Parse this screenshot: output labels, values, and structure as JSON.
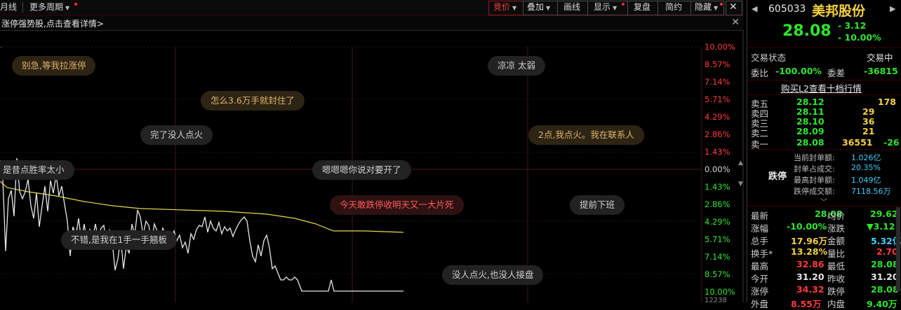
{
  "toolbar": {
    "left_items": [
      {
        "label": "月线"
      },
      {
        "label": "更多周期"
      }
    ],
    "right_items": [
      {
        "label": "竞价",
        "active": true
      },
      {
        "label": "叠加"
      },
      {
        "label": "画线"
      },
      {
        "label": "显示"
      },
      {
        "label": "复盘"
      },
      {
        "label": "简约"
      },
      {
        "label": "隐藏"
      }
    ],
    "close_icon": "close-icon"
  },
  "infobar": {
    "text": "涨停强势股,点击查看详情>"
  },
  "chart": {
    "pct_labels": [
      {
        "text": "10.00%",
        "color": "#ff3b3b"
      },
      {
        "text": "8.57%",
        "color": "#ff3b3b"
      },
      {
        "text": "7.14%",
        "color": "#ff3b3b"
      },
      {
        "text": "5.71%",
        "color": "#ff3b3b"
      },
      {
        "text": "4.29%",
        "color": "#ff3b3b"
      },
      {
        "text": "2.86%",
        "color": "#ff3b3b"
      },
      {
        "text": "1.43%",
        "color": "#ff3b3b"
      },
      {
        "text": "0.00%",
        "color": "#d8d8d8"
      },
      {
        "text": "1.43%",
        "color": "#2ee62e"
      },
      {
        "text": "2.86%",
        "color": "#2ee62e"
      },
      {
        "text": "4.29%",
        "color": "#2ee62e"
      },
      {
        "text": "5.71%",
        "color": "#2ee62e"
      },
      {
        "text": "7.14%",
        "color": "#2ee62e"
      },
      {
        "text": "8.57%",
        "color": "#2ee62e"
      },
      {
        "text": "10.00%",
        "color": "#2ee62e"
      }
    ],
    "bottom_partial": "12238",
    "bubbles": [
      {
        "text": "别急,等我拉涨停",
        "style": "yellow"
      },
      {
        "text": "怎么3.6万手就封住了",
        "style": "yellow"
      },
      {
        "text": "完了没人点火",
        "style": "gray"
      },
      {
        "text": "是昔点胜率太小",
        "style": "gray"
      },
      {
        "text": "嗯嗯嗯你说对要开了",
        "style": "gray"
      },
      {
        "text": "今天敢跌停收明天又一大片死",
        "style": "red"
      },
      {
        "text": "不错,是我在1手一手翘板",
        "style": "gray"
      },
      {
        "text": "凉凉 太弱",
        "style": "gray"
      },
      {
        "text": "2点,我点火。我在联系人",
        "style": "yellow"
      },
      {
        "text": "提前下班",
        "style": "gray"
      },
      {
        "text": "没人点火,也没人接盘",
        "style": "gray"
      }
    ]
  },
  "panel": {
    "code": "605033",
    "name": "美邦股份",
    "price": "28.08",
    "change": "- 3.12",
    "change_pct": "- 10.00%",
    "status_label": "交易状态",
    "status_value": "交易中",
    "weibi_label": "委比",
    "weibi_value": "-100.00%",
    "weicha_label": "委差",
    "weicha_value": "-36815",
    "l2_link": "购买L2查看十档行情",
    "asks": [
      {
        "label": "卖五",
        "price": "28.12",
        "vol": "178",
        "diff": ""
      },
      {
        "label": "卖四",
        "price": "28.11",
        "vol": "29",
        "diff": ""
      },
      {
        "label": "卖三",
        "price": "28.10",
        "vol": "36",
        "diff": ""
      },
      {
        "label": "卖二",
        "price": "28.09",
        "vol": "21",
        "diff": ""
      },
      {
        "label": "卖一",
        "price": "28.08",
        "vol": "36551",
        "diff": "-26"
      }
    ],
    "limit_label": "跌停",
    "limit_info": [
      {
        "label": "当前封单额:",
        "value": "1.026亿"
      },
      {
        "label": "封单占成交:",
        "value": "20.35%"
      },
      {
        "label": "最高封单额:",
        "value": "1.049亿"
      },
      {
        "label": "跌停成交额:",
        "value": "7118.56万"
      }
    ],
    "stats": [
      {
        "l1": "最新",
        "v1": "28.08",
        "c1": "green",
        "l2": "均价",
        "v2": "29.62",
        "c2": "green"
      },
      {
        "l1": "涨幅",
        "v1": "-10.00%",
        "c1": "green",
        "l2": "涨跌",
        "v2": "▼3.12",
        "c2": "green"
      },
      {
        "l1": "总手",
        "v1": "17.96万",
        "c1": "yellow",
        "l2": "金额",
        "v2": "5.32亿",
        "c2": "cyan"
      },
      {
        "l1": "换手*",
        "v1": "13.28%",
        "c1": "yellow",
        "l2": "量比",
        "v2": "2.70",
        "c2": "red"
      },
      {
        "l1": "最高",
        "v1": "32.86",
        "c1": "red",
        "l2": "最低",
        "v2": "28.08",
        "c2": "green"
      },
      {
        "l1": "今开",
        "v1": "31.20",
        "c1": "white",
        "l2": "昨收",
        "v2": "31.20",
        "c2": "white"
      },
      {
        "l1": "涨停",
        "v1": "34.32",
        "c1": "red",
        "l2": "跌停",
        "v2": "28.08",
        "c2": "green"
      },
      {
        "l1": "外盘",
        "v1": "8.55万",
        "c1": "red",
        "l2": "内盘",
        "v2": "9.40万",
        "c2": "green"
      }
    ]
  }
}
